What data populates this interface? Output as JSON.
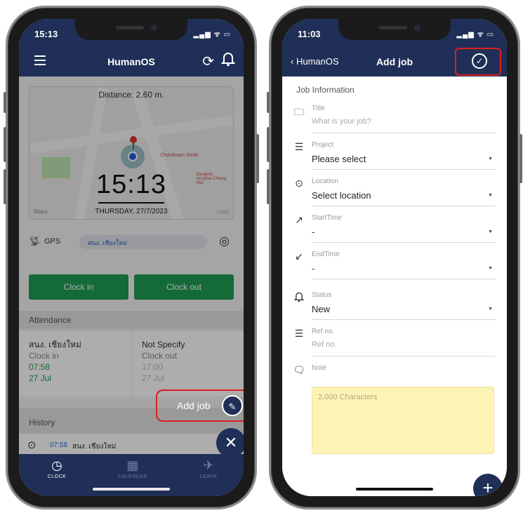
{
  "left": {
    "status": {
      "time": "15:13",
      "indicators": "▂▄▆ ᯤ ▭"
    },
    "nav": {
      "title": "HumanOS"
    },
    "map": {
      "distance": "Distance: 2.60 m.",
      "clock": "15:13",
      "date": "THURSDAY, 27/7/2023",
      "poi": "Choluksam Smile",
      "poi2": "Bangkok Hospital Chiang Mai",
      "attribution": "Maps",
      "legal": "Legal"
    },
    "gps": {
      "label": "GPS",
      "location": "สนง. เชียงใหม่"
    },
    "buttons": {
      "clock_in": "Clock in",
      "clock_out": "Clock out"
    },
    "attendance": {
      "header": "Attendance",
      "left": {
        "place": "สนง. เชียงใหม่",
        "type": "Clock in",
        "time": "07:58",
        "date": "27 Jul"
      },
      "right": {
        "place": "Not Specify",
        "type": "Clock out",
        "time": "17:00",
        "date": "27 Jul"
      }
    },
    "history": {
      "header": "History",
      "rows": [
        {
          "time": "07:58",
          "place": "สนง. เชียงใหม่"
        }
      ]
    },
    "fab": {
      "add_job_label": "Add job",
      "close": "✕"
    },
    "tabs": [
      {
        "label": "CLOCK",
        "icon": "clock-icon",
        "glyph": "◷"
      },
      {
        "label": "CALENDAR",
        "icon": "calendar-icon",
        "glyph": "▦"
      },
      {
        "label": "LEAVE",
        "icon": "plane-icon",
        "glyph": "✈"
      }
    ]
  },
  "right": {
    "status": {
      "time": "11:03",
      "indicators": "▂▄▆ ᯤ ▭"
    },
    "nav": {
      "back": "HumanOS",
      "title": "Add job"
    },
    "form": {
      "section": "Job Information",
      "title": {
        "label": "Title",
        "placeholder": "What is your job?"
      },
      "project": {
        "label": "Project",
        "value": "Please select"
      },
      "location": {
        "label": "Location",
        "value": "Select location"
      },
      "start": {
        "label": "StartTime",
        "value": "-"
      },
      "end": {
        "label": "EndTime",
        "value": "-"
      },
      "status": {
        "label": "Status",
        "value": "New"
      },
      "ref": {
        "label": "Ref no.",
        "placeholder": "Ref no."
      },
      "note": {
        "label": "Note",
        "placeholder": "2,000 Characters"
      }
    },
    "fab": "+"
  },
  "colors": {
    "navy": "#1f2f57",
    "green": "#1f9d55",
    "highlight": "#d9201f",
    "note_bg": "#fdf3b5"
  }
}
